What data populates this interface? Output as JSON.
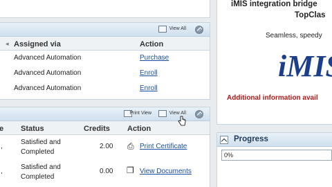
{
  "assignments": {
    "view_all": "View All",
    "columns": [
      "Assigned via",
      "Action"
    ],
    "rows": [
      {
        "assigned_via": "Advanced Automation",
        "action": "Purchase"
      },
      {
        "assigned_via": "Advanced Automation",
        "action": "Enroll"
      },
      {
        "assigned_via": "Advanced Automation",
        "action": "Enroll"
      }
    ]
  },
  "history": {
    "print_view": "Print View",
    "view_all": "View All",
    "columns": [
      "e",
      "Status",
      "Credits",
      "Action"
    ],
    "rows": [
      {
        "status": "Satisfied and Completed",
        "credits": "2.00",
        "action": "Print Certificate"
      },
      {
        "status": "Satisfied and Completed",
        "credits": "0.00",
        "action": "View Documents"
      }
    ]
  },
  "promo": {
    "line1": "iMIS integration bridge",
    "line2": "TopClas",
    "line3": "Seamless, speedy",
    "logo": "iMIS",
    "line4": "Additional information avail"
  },
  "progress": {
    "title": "Progress",
    "value": 0,
    "label": "0%"
  },
  "colors": {
    "link": "#1a4fa0",
    "panel_header": "#cfe0ee",
    "logo": "#1c3f8c",
    "alert": "#b01818"
  }
}
